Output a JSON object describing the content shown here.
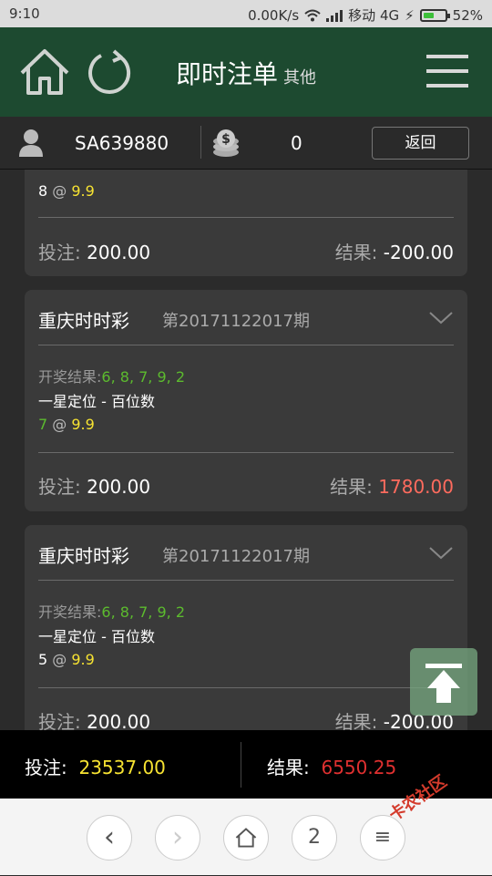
{
  "status": {
    "time": "9:10",
    "speed": "0.00K/s",
    "carrier": "移动 4G",
    "battery": "52%",
    "battery_level": 0.52
  },
  "header": {
    "title": "即时注单",
    "subtitle": "其他"
  },
  "user": {
    "account": "SA639880",
    "balance": "0",
    "back_label": "返回"
  },
  "cards": [
    {
      "pick_num": "8",
      "at": "@",
      "odds": "9.9",
      "stake_label": "投注:",
      "stake": "200.00",
      "result_label": "结果:",
      "result": "-200.00"
    },
    {
      "game": "重庆时时彩",
      "period": "第20171122017期",
      "draw_label": "开奖结果:",
      "draw_numbers": "6, 8, 7, 9, 2",
      "play": "一星定位 - 百位数",
      "pick_num": "7",
      "at": "@",
      "odds": "9.9",
      "stake_label": "投注:",
      "stake": "200.00",
      "result_label": "结果:",
      "result": "1780.00"
    },
    {
      "game": "重庆时时彩",
      "period": "第20171122017期",
      "draw_label": "开奖结果:",
      "draw_numbers": "6, 8, 7, 9, 2",
      "play": "一星定位 - 百位数",
      "pick_num": "5",
      "at": "@",
      "odds": "9.9",
      "stake_label": "投注:",
      "stake": "200.00",
      "result_label": "结果:",
      "result": "-200.00"
    }
  ],
  "totals": {
    "stake_label": "投注:",
    "stake": "23537.00",
    "result_label": "结果:",
    "result": "6550.25"
  },
  "browser": {
    "back": "‹",
    "forward": "›",
    "tabs": "2",
    "menu": "≡"
  },
  "watermark": "卡农社区",
  "icons": [
    "home-icon",
    "refresh-icon",
    "menu-icon",
    "user-icon",
    "coins-icon",
    "chevron-down-icon",
    "arrow-up-icon"
  ]
}
